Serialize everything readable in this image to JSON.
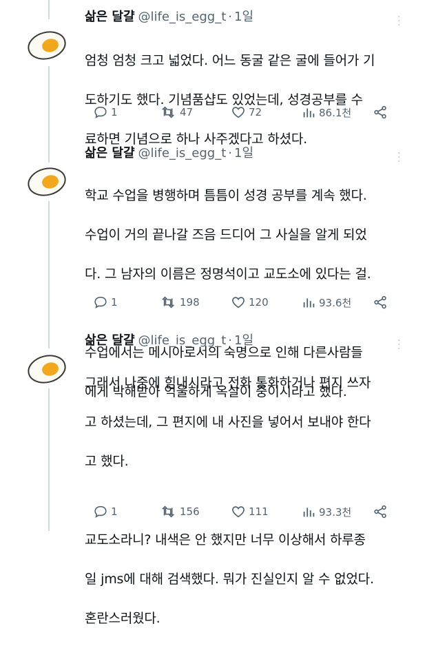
{
  "tweets": [
    {
      "name": "삶은 달걀",
      "handle": "@life_is_egg_t",
      "dot": "·",
      "time": "1일",
      "lines": [
        "엄청 엄청 크고 넓었다. 어느 동굴 같은 굴에 들어가 기",
        "도하기도 했다. 기념품샵도 있었는데, 성경공부를 수",
        "료하면 기념으로 하나 사주겠다고 하셨다."
      ],
      "replies": "1",
      "retweets": "47",
      "likes": "72",
      "views": "86.1천"
    },
    {
      "name": "삶은 달걀",
      "handle": "@life_is_egg_t",
      "dot": "·",
      "time": "1일",
      "lines": [
        "학교 수업을 병행하며 틈틈이 성경 공부를 계속 했다.",
        "수업이 거의 끝나갈 즈음 드디어 그 사실을 알게 되었",
        "다. 그 남자의 이름은 정명석이고 교도소에 있다는 걸.",
        "",
        "수업에서는 메시아로서의 숙명으로 인해 다른사람들",
        "에게 박해받아 억울하게 옥살이 중이시라고 했다."
      ],
      "replies": "1",
      "retweets": "198",
      "likes": "120",
      "views": "93.6천"
    },
    {
      "name": "삶은 달걀",
      "handle": "@life_is_egg_t",
      "dot": "·",
      "time": "1일",
      "lines": [
        "그래서 나중에 힘내시라고 전화 통화하거나 편지 쓰자",
        "고 하셨는데, 그 편지에 내 사진을 넣어서 보내야 한다",
        "고 했다.",
        "",
        "교도소라니? 내색은 안 했지만 너무 이상해서 하루종",
        "일 jms에 대해 검색했다. 뭐가 진실인지 알 수 없었다.",
        "혼란스러웠다."
      ],
      "replies": "1",
      "retweets": "156",
      "likes": "111",
      "views": "93.3천"
    }
  ],
  "icons": {
    "avatar": "boiled-egg-icon",
    "more": "more-icon",
    "reply": "reply-icon",
    "retweet": "retweet-icon",
    "like": "heart-icon",
    "views": "views-icon",
    "share": "share-icon"
  },
  "colors": {
    "text": "#0f1419",
    "muted": "#536471",
    "thread_line": "#cfd9de",
    "egg_yolk": "#f2a81d",
    "egg_white": "#fbfaf3"
  }
}
